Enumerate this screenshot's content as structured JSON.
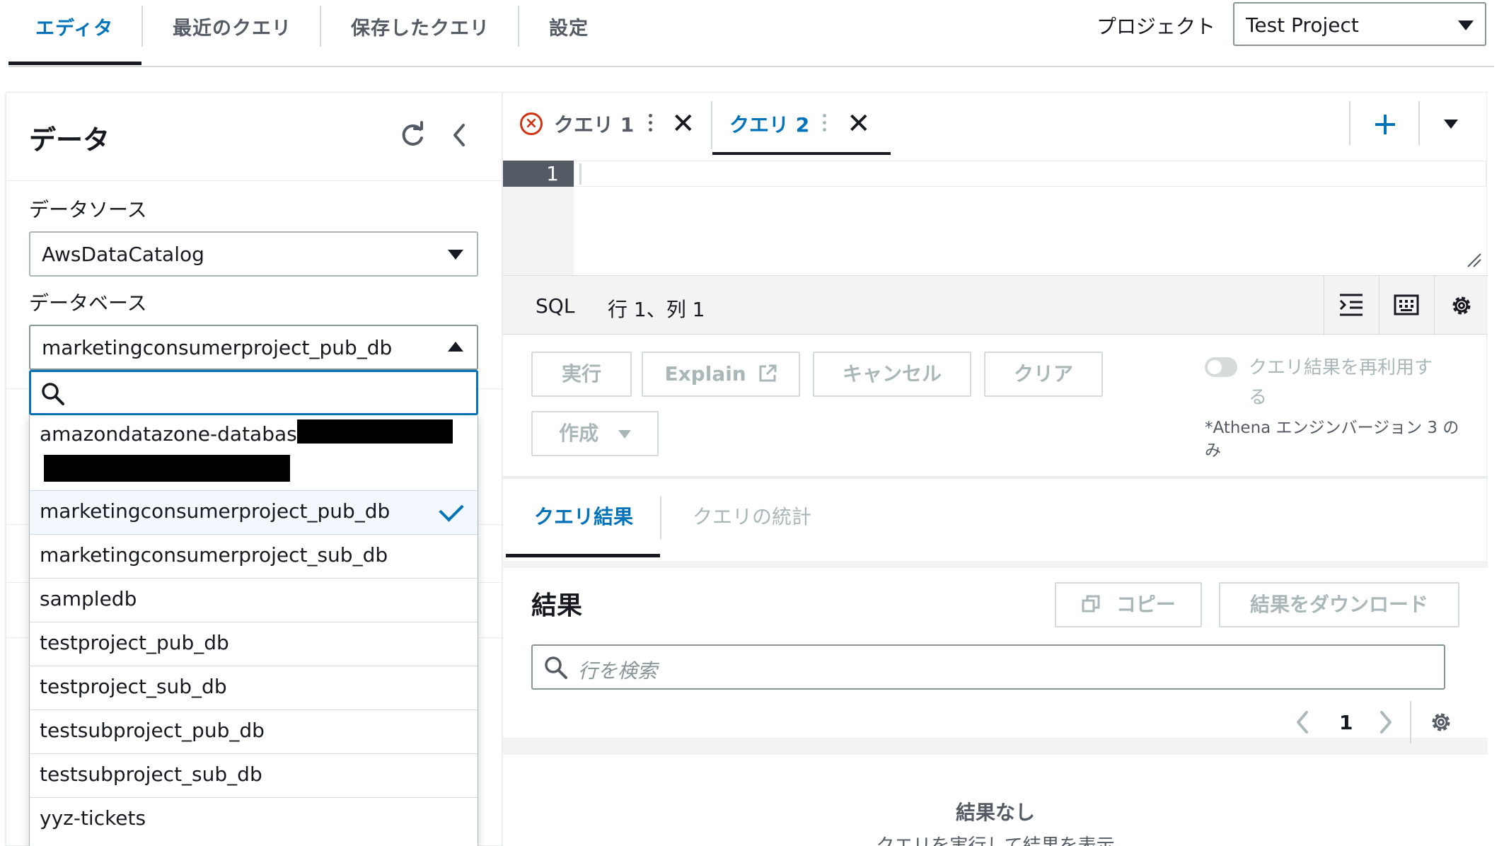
{
  "top_nav": {
    "tabs": [
      "エディタ",
      "最近のクエリ",
      "保存したクエリ",
      "設定"
    ],
    "project_label": "プロジェクト",
    "project_value": "Test Project"
  },
  "left_panel": {
    "title": "データ",
    "datasource_label": "データソース",
    "datasource_value": "AwsDataCatalog",
    "database_label": "データベース",
    "database_value": "marketingconsumerproject_pub_db",
    "search_value": "",
    "options": [
      "amazondatazone-database-",
      "marketingconsumerproject_pub_db",
      "marketingconsumerproject_sub_db",
      "sampledb",
      "testproject_pub_db",
      "testproject_sub_db",
      "testsubproject_pub_db",
      "testsubproject_sub_db",
      "yyz-tickets"
    ]
  },
  "editor": {
    "tabs": [
      "クエリ 1",
      "クエリ 2"
    ],
    "line_number": "1",
    "status_lang": "SQL",
    "status_pos": "行 1、列 1"
  },
  "actions": {
    "run": "実行",
    "explain": "Explain",
    "cancel": "キャンセル",
    "clear": "クリア",
    "create": "作成",
    "reuse_label_1": "クエリ結果を再利用す",
    "reuse_label_2": "る",
    "athena_note_1": "*Athena エンジンバージョン 3 の",
    "athena_note_2": "み"
  },
  "results": {
    "tabs": [
      "クエリ結果",
      "クエリの統計"
    ],
    "title": "結果",
    "copy": "コピー",
    "download": "結果をダウンロード",
    "search_placeholder": "行を検索",
    "page": "1",
    "empty_title": "結果なし",
    "empty_sub": "クエリを実行して結果を表示"
  },
  "colors": {
    "accent": "#0073bb",
    "error": "#d13212",
    "text": "#16191f",
    "disabled": "#aab7b8"
  }
}
